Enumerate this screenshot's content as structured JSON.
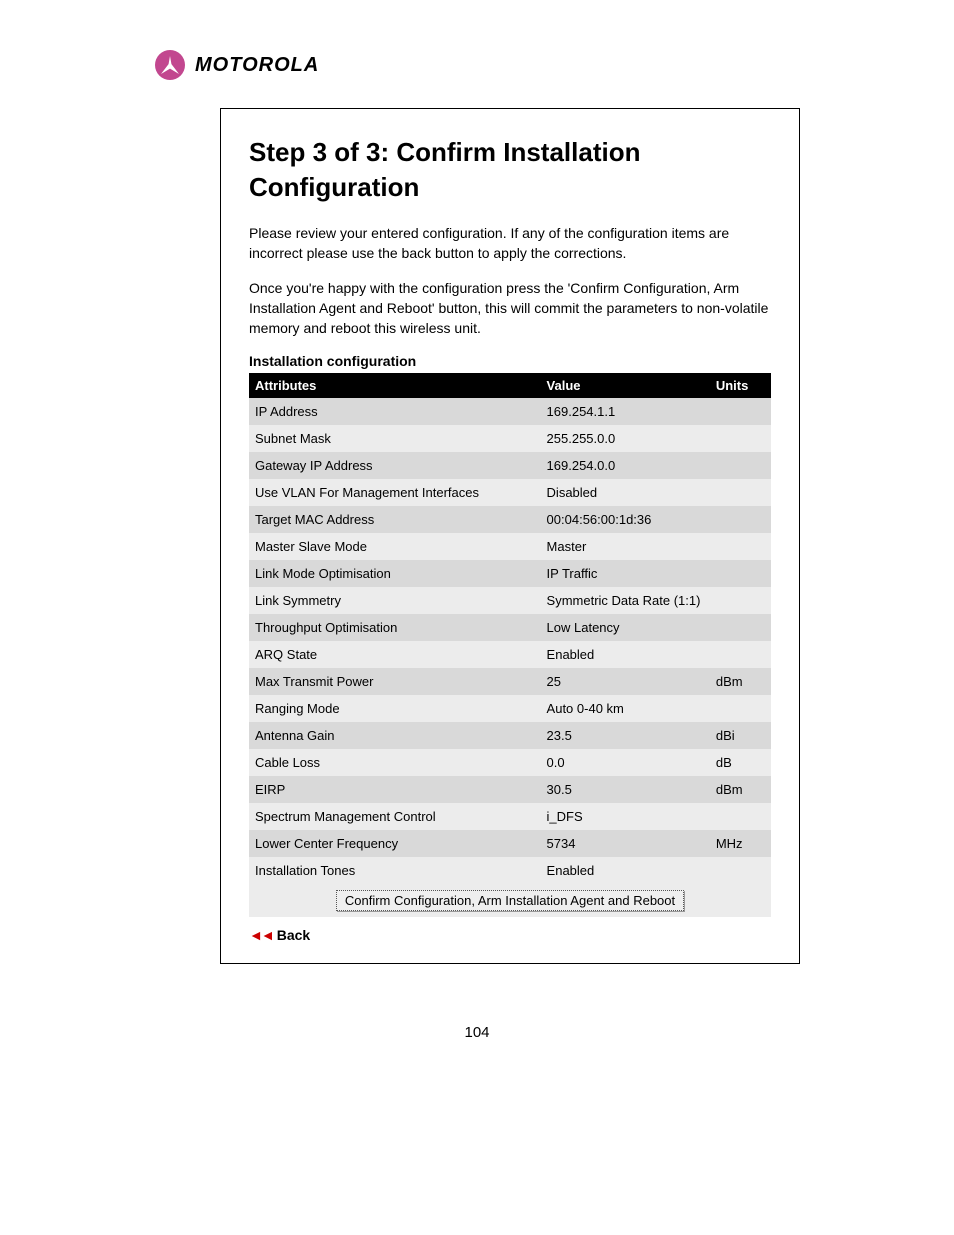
{
  "brand": {
    "name": "MOTOROLA"
  },
  "title": "Step 3 of 3: Confirm Installation Configuration",
  "paragraphs": [
    "Please review your entered configuration. If any of the configuration items are incorrect please use the back button to apply the corrections.",
    "Once you're happy with the configuration press the 'Confirm Configuration, Arm Installation Agent and Reboot' button, this will commit the parameters to non-volatile memory and reboot this wireless unit."
  ],
  "table": {
    "caption": "Installation configuration",
    "headers": {
      "attr": "Attributes",
      "value": "Value",
      "units": "Units"
    },
    "rows": [
      {
        "attr": "IP Address",
        "value": "169.254.1.1",
        "units": ""
      },
      {
        "attr": "Subnet Mask",
        "value": "255.255.0.0",
        "units": ""
      },
      {
        "attr": "Gateway IP Address",
        "value": "169.254.0.0",
        "units": ""
      },
      {
        "attr": "Use VLAN For Management Interfaces",
        "value": "Disabled",
        "units": ""
      },
      {
        "attr": "Target MAC Address",
        "value": "00:04:56:00:1d:36",
        "units": ""
      },
      {
        "attr": "Master Slave Mode",
        "value": "Master",
        "units": ""
      },
      {
        "attr": "Link Mode Optimisation",
        "value": "IP Traffic",
        "units": ""
      },
      {
        "attr": "Link Symmetry",
        "value": "Symmetric Data Rate (1:1)",
        "units": ""
      },
      {
        "attr": "Throughput Optimisation",
        "value": "Low Latency",
        "units": ""
      },
      {
        "attr": "ARQ State",
        "value": "Enabled",
        "units": ""
      },
      {
        "attr": "Max Transmit Power",
        "value": "25",
        "units": "dBm"
      },
      {
        "attr": "Ranging Mode",
        "value": "Auto 0-40 km",
        "units": ""
      },
      {
        "attr": "Antenna Gain",
        "value": "23.5",
        "units": "dBi"
      },
      {
        "attr": "Cable Loss",
        "value": "0.0",
        "units": "dB"
      },
      {
        "attr": "EIRP",
        "value": "30.5",
        "units": "dBm"
      },
      {
        "attr": "Spectrum Management Control",
        "value": "i_DFS",
        "units": ""
      },
      {
        "attr": "Lower Center Frequency",
        "value": "5734",
        "units": "MHz"
      },
      {
        "attr": "Installation Tones",
        "value": "Enabled",
        "units": ""
      }
    ]
  },
  "confirm_button": "Confirm Configuration, Arm Installation Agent and Reboot",
  "back_label": "Back",
  "page_number": "104"
}
